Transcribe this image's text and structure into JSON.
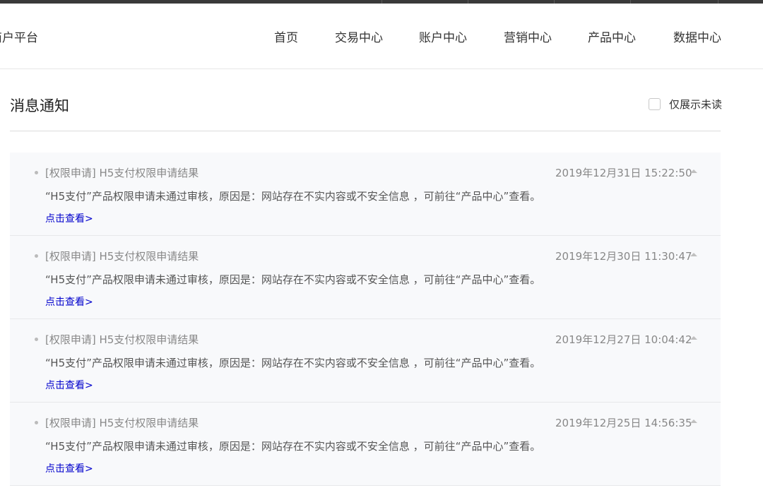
{
  "header": {
    "brand": "商户平台",
    "nav": [
      "首页",
      "交易中心",
      "账户中心",
      "营销中心",
      "产品中心",
      "数据中心"
    ]
  },
  "page": {
    "title": "消息通知",
    "unread_only_label": "仅展示未读",
    "unread_only_checked": false
  },
  "messages": [
    {
      "title": "[权限申请] H5支付权限申请结果",
      "time": "2019年12月31日 15:22:50",
      "body": "“H5支付”产品权限申请未通过审核，原因是：网站存在不实内容或不安全信息 ，可前往“产品中心”查看。",
      "link": "点击查看>"
    },
    {
      "title": "[权限申请] H5支付权限申请结果",
      "time": "2019年12月30日 11:30:47",
      "body": "“H5支付”产品权限申请未通过审核，原因是：网站存在不实内容或不安全信息 ，可前往“产品中心”查看。",
      "link": "点击查看>"
    },
    {
      "title": "[权限申请] H5支付权限申请结果",
      "time": "2019年12月27日 10:04:42",
      "body": "“H5支付”产品权限申请未通过审核，原因是：网站存在不实内容或不安全信息 ，可前往“产品中心”查看。",
      "link": "点击查看>"
    },
    {
      "title": "[权限申请] H5支付权限申请结果",
      "time": "2019年12月25日 14:56:35",
      "body": "“H5支付”产品权限申请未通过审核，原因是：网站存在不实内容或不安全信息 ，可前往“产品中心”查看。",
      "link": "点击查看>"
    }
  ],
  "colors": {
    "top_bar": "#3a3a3a",
    "link": "#0000cc",
    "item_background": "#f8f9fb",
    "muted_text": "#888888"
  }
}
